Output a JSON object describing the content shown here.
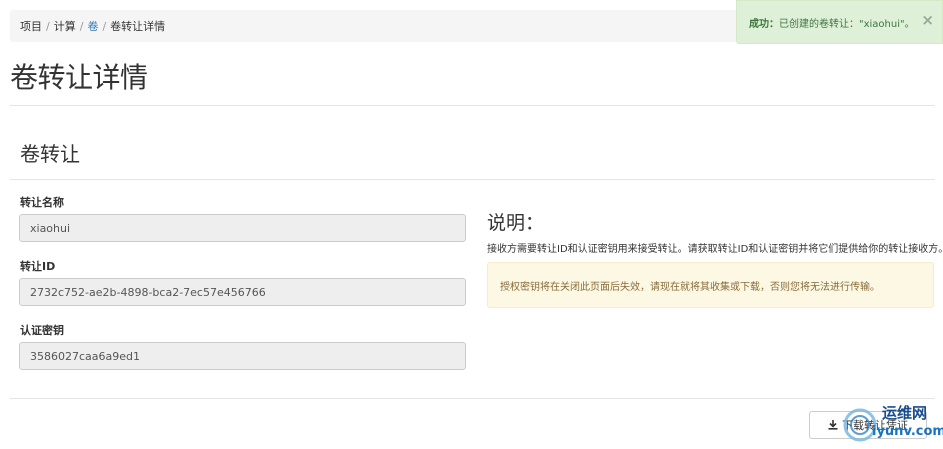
{
  "breadcrumb": {
    "items": [
      "项目",
      "计算",
      "卷",
      "卷转让详情"
    ]
  },
  "page": {
    "title": "卷转让详情"
  },
  "modal": {
    "title": "卷转让",
    "fields": [
      {
        "label": "转让名称",
        "value": "xiaohui"
      },
      {
        "label": "转让ID",
        "value": "2732c752-ae2b-4898-bca2-7ec57e456766"
      },
      {
        "label": "认证密钥",
        "value": "3586027caa6a9ed1"
      }
    ],
    "help": {
      "title": "说明：",
      "text": "接收方需要转让ID和认证密钥用来接受转让。请获取转让ID和认证密钥并将它们提供给你的转让接收方。",
      "warning": "授权密钥将在关闭此页面后失效，请现在就将其收集或下载，否则您将无法进行传输。"
    },
    "download_label": "下载转让凭证"
  },
  "alert": {
    "prefix": "成功：",
    "message": "已创建的卷转让：\"xiaohui\"。",
    "close": "×"
  },
  "watermark": {
    "line1": "运维网",
    "line2": "iyunv.com"
  },
  "colors": {
    "link": "#337ab7",
    "success_bg": "#dff0d8",
    "warning_bg": "#fcf8e3"
  }
}
